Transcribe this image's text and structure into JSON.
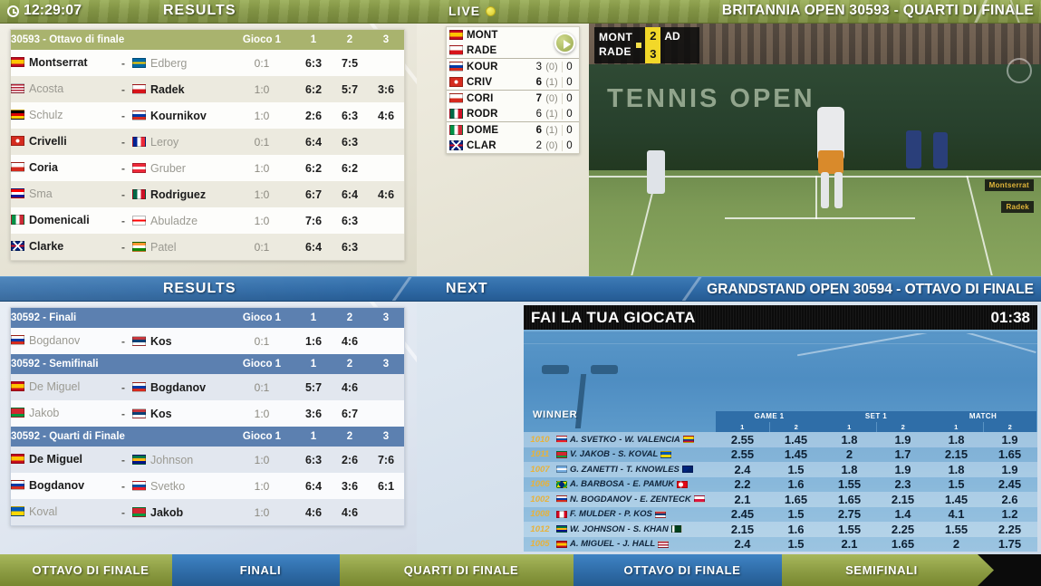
{
  "header": {
    "clock": "12:29:07",
    "results_label": "RESULTS",
    "live_label": "LIVE",
    "tournament": "BRITANNIA OPEN 30593 - QUARTI DI FINALE"
  },
  "mid_bar": {
    "results_label": "RESULTS",
    "next_label": "NEXT",
    "tournament": "GRANDSTAND OPEN 30594 - OTTAVO DI FINALE"
  },
  "results_top": {
    "columns": [
      "Gioco 1",
      "1",
      "2",
      "3"
    ],
    "groups": [
      {
        "title": "30593 - Ottavo di finale",
        "rows": [
          {
            "p1": "Montserrat",
            "p1_flag": "es",
            "p1_win": true,
            "p2": "Edberg",
            "p2_flag": "se",
            "p2_win": false,
            "games": "0:1",
            "s1": "6:3",
            "s2": "7:5",
            "s3": ""
          },
          {
            "p1": "Acosta",
            "p1_flag": "us",
            "p1_win": false,
            "p2": "Radek",
            "p2_flag": "cz",
            "p2_win": true,
            "games": "1:0",
            "s1": "6:2",
            "s2": "5:7",
            "s3": "3:6"
          },
          {
            "p1": "Schulz",
            "p1_flag": "de",
            "p1_win": false,
            "p2": "Kournikov",
            "p2_flag": "ru",
            "p2_win": true,
            "games": "1:0",
            "s1": "2:6",
            "s2": "6:3",
            "s3": "4:6"
          },
          {
            "p1": "Crivelli",
            "p1_flag": "ch",
            "p1_win": true,
            "p2": "Leroy",
            "p2_flag": "fr",
            "p2_win": false,
            "games": "0:1",
            "s1": "6:4",
            "s2": "6:3",
            "s3": ""
          },
          {
            "p1": "Coria",
            "p1_flag": "cl",
            "p1_win": true,
            "p2": "Gruber",
            "p2_flag": "at",
            "p2_win": false,
            "games": "1:0",
            "s1": "6:2",
            "s2": "6:2",
            "s3": ""
          },
          {
            "p1": "Sma",
            "p1_flag": "hr",
            "p1_win": false,
            "p2": "Rodriguez",
            "p2_flag": "mx",
            "p2_win": true,
            "games": "1:0",
            "s1": "6:7",
            "s2": "6:4",
            "s3": "4:6"
          },
          {
            "p1": "Domenicali",
            "p1_flag": "it",
            "p1_win": true,
            "p2": "Abuladze",
            "p2_flag": "ge",
            "p2_win": false,
            "games": "1:0",
            "s1": "7:6",
            "s2": "6:3",
            "s3": ""
          },
          {
            "p1": "Clarke",
            "p1_flag": "gb",
            "p1_win": true,
            "p2": "Patel",
            "p2_flag": "in",
            "p2_win": false,
            "games": "0:1",
            "s1": "6:4",
            "s2": "6:3",
            "s3": ""
          }
        ]
      }
    ]
  },
  "live_board": {
    "featured": {
      "p1": "MONT",
      "p1_flag": "es",
      "p2": "RADE",
      "p2_flag": "cz"
    },
    "matches": [
      {
        "p1": "KOUR",
        "p1_flag": "ru",
        "p1_games": "3",
        "p1_tb": "(0)",
        "p1_pts": "0",
        "p1_bold": false,
        "p2": "CRIV",
        "p2_flag": "ch",
        "p2_games": "6",
        "p2_tb": "(1)",
        "p2_pts": "0",
        "p2_bold": true
      },
      {
        "p1": "CORI",
        "p1_flag": "cl",
        "p1_games": "7",
        "p1_tb": "(0)",
        "p1_pts": "0",
        "p1_bold": true,
        "p2": "RODR",
        "p2_flag": "mx",
        "p2_games": "6",
        "p2_tb": "(1)",
        "p2_pts": "0",
        "p2_bold": false
      },
      {
        "p1": "DOME",
        "p1_flag": "it",
        "p1_games": "6",
        "p1_tb": "(1)",
        "p1_pts": "0",
        "p1_bold": true,
        "p2": "CLAR",
        "p2_flag": "gb",
        "p2_games": "2",
        "p2_tb": "(0)",
        "p2_pts": "0",
        "p2_bold": false
      }
    ]
  },
  "video": {
    "wall_text": "TENNIS OPEN",
    "overlay": {
      "p1": "MONT",
      "p2": "RADE",
      "p1_score": "2",
      "p2_score": "3",
      "p1_adv": "AD"
    },
    "side_tags": [
      "Montserrat",
      "Radek"
    ]
  },
  "results_bottom": {
    "columns": [
      "Gioco 1",
      "1",
      "2",
      "3"
    ],
    "groups": [
      {
        "title": "30592 - Finali",
        "rows": [
          {
            "p1": "Bogdanov",
            "p1_flag": "ru",
            "p1_win": false,
            "p2": "Kos",
            "p2_flag": "rs",
            "p2_win": true,
            "games": "0:1",
            "s1": "1:6",
            "s2": "4:6",
            "s3": ""
          }
        ]
      },
      {
        "title": "30592 - Semifinali",
        "rows": [
          {
            "p1": "De Miguel",
            "p1_flag": "es",
            "p1_win": false,
            "p2": "Bogdanov",
            "p2_flag": "ru",
            "p2_win": true,
            "games": "0:1",
            "s1": "5:7",
            "s2": "4:6",
            "s3": ""
          },
          {
            "p1": "Jakob",
            "p1_flag": "by",
            "p1_win": false,
            "p2": "Kos",
            "p2_flag": "rs",
            "p2_win": true,
            "games": "1:0",
            "s1": "3:6",
            "s2": "6:7",
            "s3": ""
          }
        ]
      },
      {
        "title": "30592 - Quarti di Finale",
        "rows": [
          {
            "p1": "De Miguel",
            "p1_flag": "es",
            "p1_win": true,
            "p2": "Johnson",
            "p2_flag": "za",
            "p2_win": false,
            "games": "1:0",
            "s1": "6:3",
            "s2": "2:6",
            "s3": "7:6"
          },
          {
            "p1": "Bogdanov",
            "p1_flag": "ru",
            "p1_win": true,
            "p2": "Svetko",
            "p2_flag": "sk",
            "p2_win": false,
            "games": "1:0",
            "s1": "6:4",
            "s2": "3:6",
            "s3": "6:1"
          },
          {
            "p1": "Koval",
            "p1_flag": "ua",
            "p1_win": false,
            "p2": "Jakob",
            "p2_flag": "by",
            "p2_win": true,
            "games": "1:0",
            "s1": "4:6",
            "s2": "4:6",
            "s3": ""
          }
        ]
      }
    ]
  },
  "odds_panel": {
    "title": "FAI LA TUA GIOCATA",
    "timer": "01:38",
    "winner_label": "WINNER",
    "groups": [
      "GAME 1",
      "SET 1",
      "MATCH"
    ],
    "sub_columns": [
      "1",
      "2"
    ],
    "rows": [
      {
        "id": "1010",
        "p1": "A. SVETKO",
        "p1_flag": "sk",
        "p2": "W. VALENCIA",
        "p2_flag": "co",
        "game1": [
          "2.55",
          "1.45"
        ],
        "set1": [
          "1.8",
          "1.9"
        ],
        "match": [
          "1.8",
          "1.9"
        ]
      },
      {
        "id": "1011",
        "p1": "V. JAKOB",
        "p1_flag": "by",
        "p2": "S. KOVAL",
        "p2_flag": "ua",
        "game1": [
          "2.55",
          "1.45"
        ],
        "set1": [
          "2",
          "1.7"
        ],
        "match": [
          "2.15",
          "1.65"
        ]
      },
      {
        "id": "1007",
        "p1": "G. ZANETTI",
        "p1_flag": "ar",
        "p2": "T. KNOWLES",
        "p2_flag": "au",
        "game1": [
          "2.4",
          "1.5"
        ],
        "set1": [
          "1.8",
          "1.9"
        ],
        "match": [
          "1.8",
          "1.9"
        ]
      },
      {
        "id": "1006",
        "p1": "A. BARBOSA",
        "p1_flag": "br",
        "p2": "E. PAMUK",
        "p2_flag": "tr",
        "game1": [
          "2.2",
          "1.6"
        ],
        "set1": [
          "1.55",
          "2.3"
        ],
        "match": [
          "1.5",
          "2.45"
        ]
      },
      {
        "id": "1002",
        "p1": "N. BOGDANOV",
        "p1_flag": "ru",
        "p2": "E. ZENTECK",
        "p2_flag": "pl",
        "game1": [
          "2.1",
          "1.65"
        ],
        "set1": [
          "1.65",
          "2.15"
        ],
        "match": [
          "1.45",
          "2.6"
        ]
      },
      {
        "id": "1008",
        "p1": "F. MULDER",
        "p1_flag": "ca",
        "p2": "P. KOS",
        "p2_flag": "rs",
        "game1": [
          "2.45",
          "1.5"
        ],
        "set1": [
          "2.75",
          "1.4"
        ],
        "match": [
          "4.1",
          "1.2"
        ]
      },
      {
        "id": "1012",
        "p1": "W. JOHNSON",
        "p1_flag": "za",
        "p2": "S. KHAN",
        "p2_flag": "pk",
        "game1": [
          "2.15",
          "1.6"
        ],
        "set1": [
          "1.55",
          "2.25"
        ],
        "match": [
          "1.55",
          "2.25"
        ]
      },
      {
        "id": "1005",
        "p1": "A. MIGUEL",
        "p1_flag": "es",
        "p2": "J. HALL",
        "p2_flag": "us",
        "game1": [
          "2.4",
          "1.5"
        ],
        "set1": [
          "2.1",
          "1.65"
        ],
        "match": [
          "2",
          "1.75"
        ]
      }
    ]
  },
  "nav": {
    "items": [
      {
        "label": "OTTAVO DI FINALE",
        "color": "green"
      },
      {
        "label": "FINALI",
        "color": "blue"
      },
      {
        "label": "QUARTI DI FINALE",
        "color": "green"
      },
      {
        "label": "OTTAVO DI FINALE",
        "color": "blue"
      },
      {
        "label": "SEMIFINALI",
        "color": "green"
      }
    ]
  }
}
